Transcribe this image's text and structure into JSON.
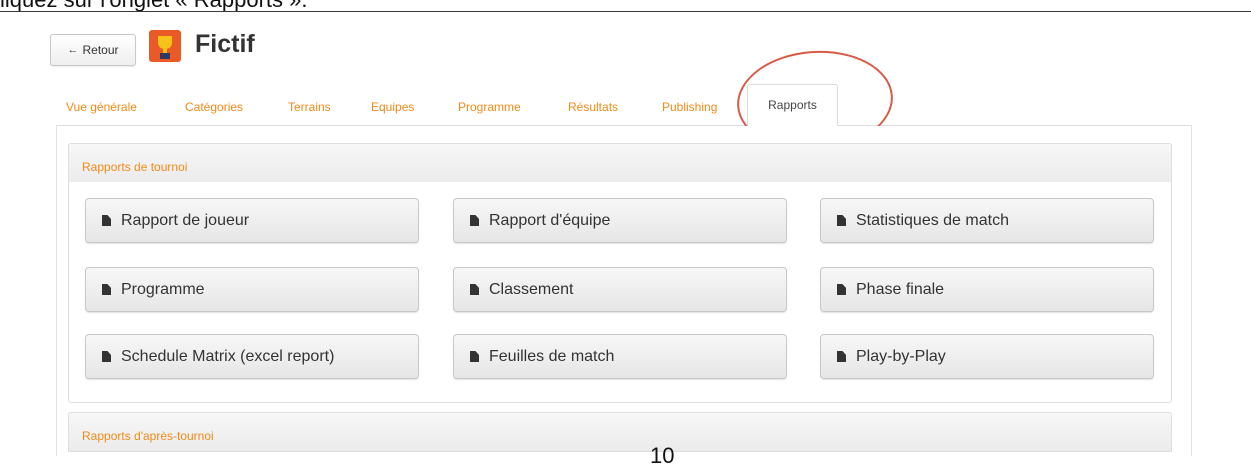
{
  "document": {
    "instruction_text": "liquez sur l'onglet « Rapports ».",
    "page_number": "10"
  },
  "header": {
    "back_label": "Retour",
    "app_title": "Fictif",
    "logo_icon": "trophy-icon"
  },
  "tabs": [
    {
      "label": "Vue générale",
      "active": false
    },
    {
      "label": "Catégories",
      "active": false
    },
    {
      "label": "Terrains",
      "active": false
    },
    {
      "label": "Equipes",
      "active": false
    },
    {
      "label": "Programme",
      "active": false
    },
    {
      "label": "Résultats",
      "active": false
    },
    {
      "label": "Publishing",
      "active": false
    },
    {
      "label": "Rapports",
      "active": true
    }
  ],
  "sections": [
    {
      "title": "Rapports de tournoi",
      "reports": [
        "Rapport de joueur",
        "Rapport d'équipe",
        "Statistiques de match",
        "Programme",
        "Classement",
        "Phase finale",
        "Schedule Matrix (excel report)",
        "Feuilles de match",
        "Play-by-Play"
      ]
    },
    {
      "title": "Rapports d'après-tournoi",
      "reports": []
    }
  ],
  "colors": {
    "accent": "#ef8a17",
    "highlight_annotation": "#d85a47",
    "logo_background": "#ea5a27"
  },
  "icons": {
    "back": "arrow-left-icon",
    "report": "document-icon"
  }
}
